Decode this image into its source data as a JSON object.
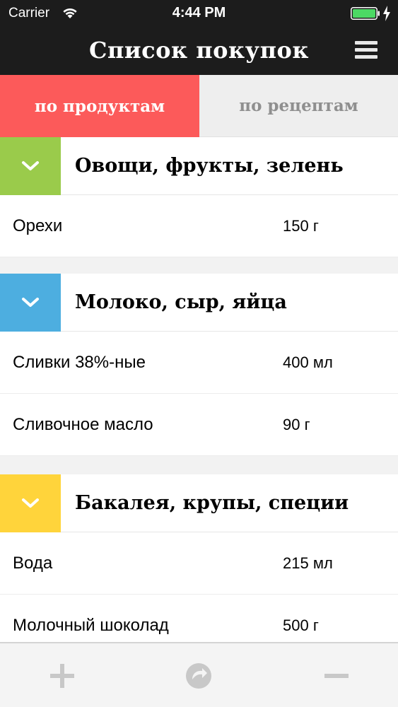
{
  "status_bar": {
    "carrier": "Carrier",
    "time": "4:44 PM",
    "battery_color": "#4cd964"
  },
  "nav": {
    "title": "Список покупок",
    "menu_icon": "hamburger-menu-icon"
  },
  "tabs": [
    {
      "label": "по продуктам",
      "active": true,
      "color": "#fc5a5a"
    },
    {
      "label": "по рецептам",
      "active": false
    }
  ],
  "categories": [
    {
      "title": "Овощи, фрукты, зелень",
      "color": "#9acb4b",
      "items": [
        {
          "name": "Орехи",
          "qty": "150 г"
        }
      ]
    },
    {
      "title": "Молоко, сыр, яйца",
      "color": "#4daee0",
      "items": [
        {
          "name": "Сливки 38%-ные",
          "qty": "400 мл"
        },
        {
          "name": "Сливочное масло",
          "qty": "90 г"
        }
      ]
    },
    {
      "title": "Бакалея, крупы, специи",
      "color": "#ffd43b",
      "items": [
        {
          "name": "Вода",
          "qty": "215 мл"
        },
        {
          "name": "Молочный шоколад",
          "qty": "500 г"
        }
      ]
    }
  ],
  "toolbar": {
    "icons": [
      "plus-icon",
      "refresh-icon",
      "minus-icon"
    ],
    "icon_color": "#c8c8c8"
  }
}
